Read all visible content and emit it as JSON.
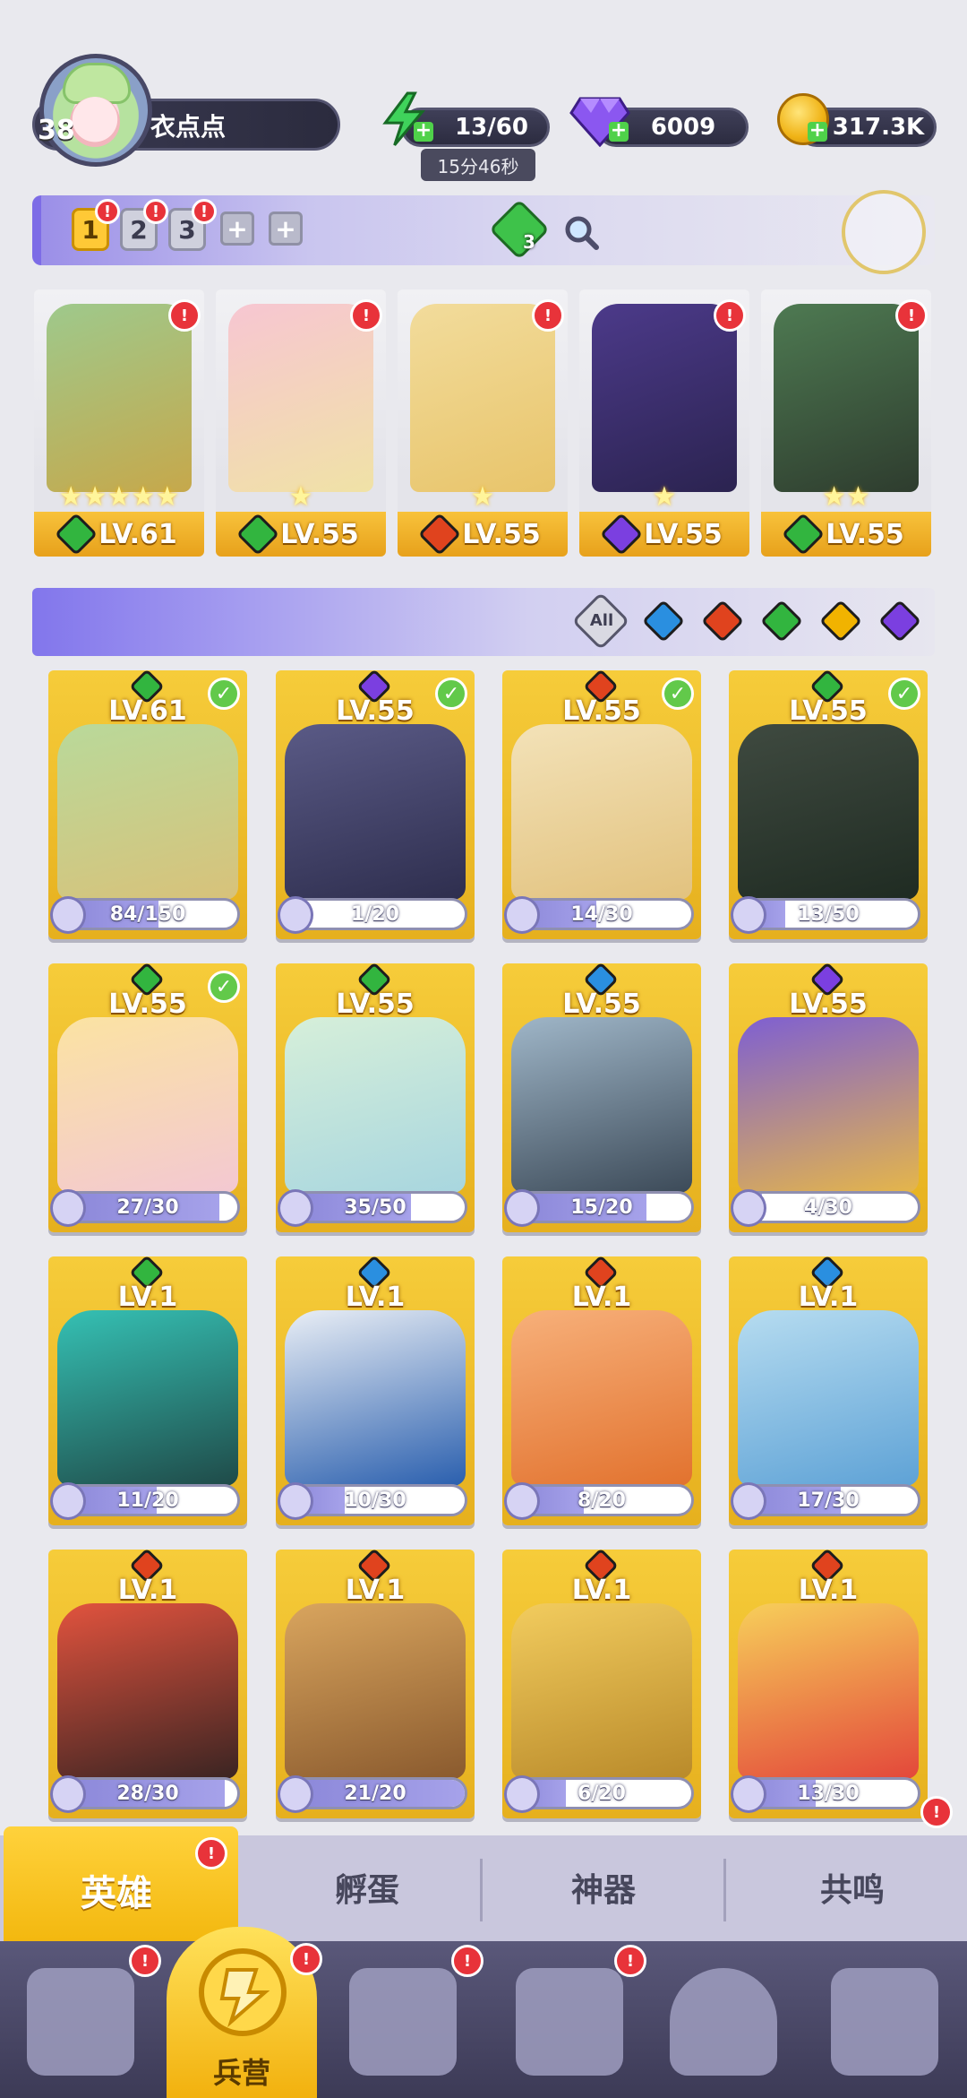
{
  "player": {
    "level": "38",
    "name": "衣点点"
  },
  "resources": {
    "energy": "13/60",
    "energy_timer": "15分46秒",
    "gems": "6009",
    "coins": "317.3K"
  },
  "team_tabs": [
    "1",
    "2",
    "3"
  ],
  "team_gem_count": "3",
  "team": [
    {
      "level": "LV.61",
      "element": "green",
      "stars": "★★★★★",
      "art": [
        "#9ec98c",
        "#c6a84b"
      ]
    },
    {
      "level": "LV.55",
      "element": "green",
      "stars": "★",
      "art": [
        "#f7c6d2",
        "#f0e2a6"
      ]
    },
    {
      "level": "LV.55",
      "element": "red",
      "stars": "★",
      "art": [
        "#f2dc9c",
        "#e8c46a"
      ]
    },
    {
      "level": "LV.55",
      "element": "purple",
      "stars": "★",
      "art": [
        "#4c3a8a",
        "#2b2350"
      ]
    },
    {
      "level": "LV.55",
      "element": "green",
      "stars": "★★",
      "art": [
        "#4e7a52",
        "#2e3c2e"
      ]
    }
  ],
  "filter": {
    "all_label": "All",
    "elements": [
      "blue",
      "red",
      "green",
      "yellow",
      "purple"
    ]
  },
  "heroes": [
    {
      "level": "LV.61",
      "element": "green",
      "progress": "84/150",
      "ratio": 0.56,
      "selected": true,
      "art": [
        "#b9d99a",
        "#d8c27a"
      ]
    },
    {
      "level": "LV.55",
      "element": "purple",
      "progress": "1/20",
      "ratio": 0.05,
      "selected": true,
      "art": [
        "#5a5a86",
        "#2e2e4e"
      ]
    },
    {
      "level": "LV.55",
      "element": "red",
      "progress": "14/30",
      "ratio": 0.47,
      "selected": true,
      "art": [
        "#f3e2b8",
        "#e2c27e"
      ]
    },
    {
      "level": "LV.55",
      "element": "green",
      "progress": "13/50",
      "ratio": 0.26,
      "selected": true,
      "art": [
        "#3f4a40",
        "#1f2b22"
      ]
    },
    {
      "level": "LV.55",
      "element": "green",
      "progress": "27/30",
      "ratio": 0.9,
      "selected": true,
      "art": [
        "#fbe3a2",
        "#f3c8d2"
      ]
    },
    {
      "level": "LV.55",
      "element": "green",
      "progress": "35/50",
      "ratio": 0.7,
      "selected": false,
      "art": [
        "#d6efd9",
        "#a8d6df"
      ]
    },
    {
      "level": "LV.55",
      "element": "blue",
      "progress": "15/20",
      "ratio": 0.75,
      "selected": false,
      "art": [
        "#9fb6c8",
        "#3c4a58"
      ]
    },
    {
      "level": "LV.55",
      "element": "purple",
      "progress": "4/30",
      "ratio": 0.13,
      "selected": false,
      "art": [
        "#7e5fd2",
        "#e5b64a"
      ]
    },
    {
      "level": "LV.1",
      "element": "green",
      "progress": "11/20",
      "ratio": 0.55,
      "selected": false,
      "art": [
        "#35c1b4",
        "#1f4a48"
      ]
    },
    {
      "level": "LV.1",
      "element": "blue",
      "progress": "10/30",
      "ratio": 0.33,
      "selected": false,
      "art": [
        "#e9eef5",
        "#2a5fae"
      ]
    },
    {
      "level": "LV.1",
      "element": "red",
      "progress": "8/20",
      "ratio": 0.4,
      "selected": false,
      "art": [
        "#f7b07a",
        "#e2722e"
      ]
    },
    {
      "level": "LV.1",
      "element": "blue",
      "progress": "17/30",
      "ratio": 0.57,
      "selected": false,
      "art": [
        "#b6dcf0",
        "#5ea2d6"
      ]
    },
    {
      "level": "LV.1",
      "element": "red",
      "progress": "28/30",
      "ratio": 0.93,
      "selected": false,
      "art": [
        "#e2533e",
        "#3a2422"
      ]
    },
    {
      "level": "LV.1",
      "element": "red",
      "progress": "21/20",
      "ratio": 1.0,
      "selected": false,
      "art": [
        "#d9a55e",
        "#8a5a2e"
      ]
    },
    {
      "level": "LV.1",
      "element": "red",
      "progress": "6/20",
      "ratio": 0.3,
      "selected": false,
      "art": [
        "#f2cc5e",
        "#b98a2a"
      ]
    },
    {
      "level": "LV.1",
      "element": "red",
      "progress": "13/30",
      "ratio": 0.43,
      "selected": false,
      "art": [
        "#f7cf5a",
        "#e3473a"
      ]
    }
  ],
  "sub_tabs": [
    "英雄",
    "孵蛋",
    "神器",
    "共鸣"
  ],
  "nav": {
    "active_label": "兵营"
  },
  "colors": {
    "accent": "#ffc936",
    "alert": "#e8333a"
  }
}
